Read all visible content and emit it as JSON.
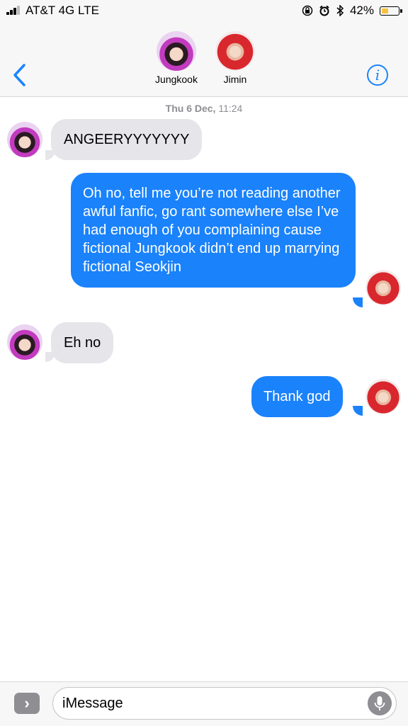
{
  "status_bar": {
    "carrier": "AT&T 4G  LTE",
    "battery_percent": "42%",
    "battery_level": 0.42,
    "icons": [
      "signal-icon",
      "orientation-lock-icon",
      "alarm-icon",
      "bluetooth-icon",
      "battery-icon"
    ]
  },
  "header": {
    "contacts": [
      {
        "name": "Jungkook"
      },
      {
        "name": "Jimin"
      }
    ],
    "back_icon": "chevron-left-icon",
    "info_glyph": "i"
  },
  "conversation": {
    "timestamp_day": "Thu 6 Dec,",
    "timestamp_time": "11:24",
    "messages": [
      {
        "from": "Jungkook",
        "direction": "incoming",
        "text": "ANGEERYYYYYYY"
      },
      {
        "from": "Jimin",
        "direction": "outgoing",
        "text": "Oh no, tell me you’re not reading another awful fanfic, go rant somewhere else I’ve had enough of you complaining cause fictional Jungkook didn’t end up marrying fictional Seokjin"
      },
      {
        "from": "Jungkook",
        "direction": "incoming",
        "text": "Eh no"
      },
      {
        "from": "Jimin",
        "direction": "outgoing",
        "text": "Thank god"
      }
    ]
  },
  "composer": {
    "placeholder": "iMessage",
    "apps_glyph": "›",
    "mic_icon": "microphone-icon"
  },
  "colors": {
    "outgoing_bubble": "#1a82fb",
    "incoming_bubble": "#e5e5ea",
    "accent": "#1a84ff",
    "battery_fill": "#f7c23b"
  }
}
